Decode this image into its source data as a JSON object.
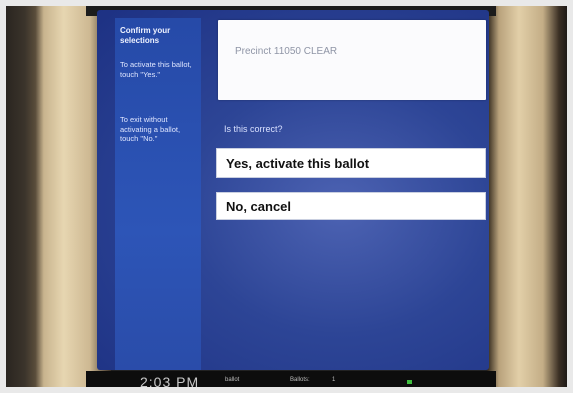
{
  "sidebar": {
    "heading": "Confirm your selections",
    "activate_instruction": "To activate this ballot, touch \"Yes.\"",
    "exit_instruction": "To exit without activating a ballot, touch \"No.\""
  },
  "info": {
    "precinct": "Precinct 11050 CLEAR"
  },
  "prompt": {
    "question": "Is this correct?"
  },
  "buttons": {
    "yes_label": "Yes, activate this ballot",
    "no_label": "No, cancel"
  },
  "status_bar": {
    "time": "2:03 PM",
    "item_a": "ballot",
    "item_b": "Ballots:",
    "item_c": "1"
  },
  "colors": {
    "screen_background": "#2d4596",
    "sidebar_background": "#2a4ca9",
    "button_background": "#ffffff",
    "status_indicator": "#3fbf3f"
  }
}
